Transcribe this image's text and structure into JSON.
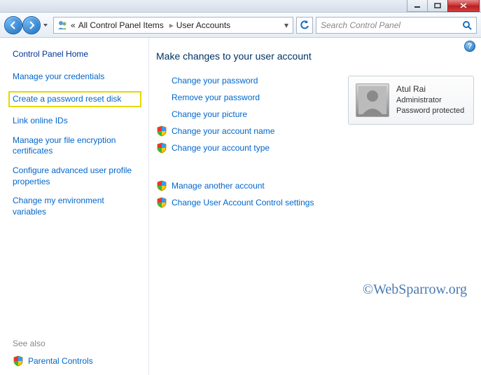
{
  "titlebar": {},
  "toolbar": {
    "breadcrumb_sep": "«",
    "breadcrumb1": "All Control Panel Items",
    "arrow": "▸",
    "breadcrumb2": "User Accounts",
    "search_placeholder": "Search Control Panel"
  },
  "sidebar": {
    "home": "Control Panel Home",
    "links": [
      "Manage your credentials",
      "Create a password reset disk",
      "Link online IDs",
      "Manage your file encryption certificates",
      "Configure advanced user profile properties",
      "Change my environment variables"
    ],
    "see_also": "See also",
    "parental": "Parental Controls"
  },
  "main": {
    "heading": "Make changes to your user account",
    "links1": [
      "Change your password",
      "Remove your password",
      "Change your picture",
      "Change your account name",
      "Change your account type"
    ],
    "shield_indices1": [
      3,
      4
    ],
    "links2": [
      "Manage another account",
      "Change User Account Control settings"
    ],
    "user": {
      "name": "Atul Rai",
      "role": "Administrator",
      "status": "Password protected"
    },
    "help": "?"
  },
  "watermark": "©WebSparrow.org"
}
